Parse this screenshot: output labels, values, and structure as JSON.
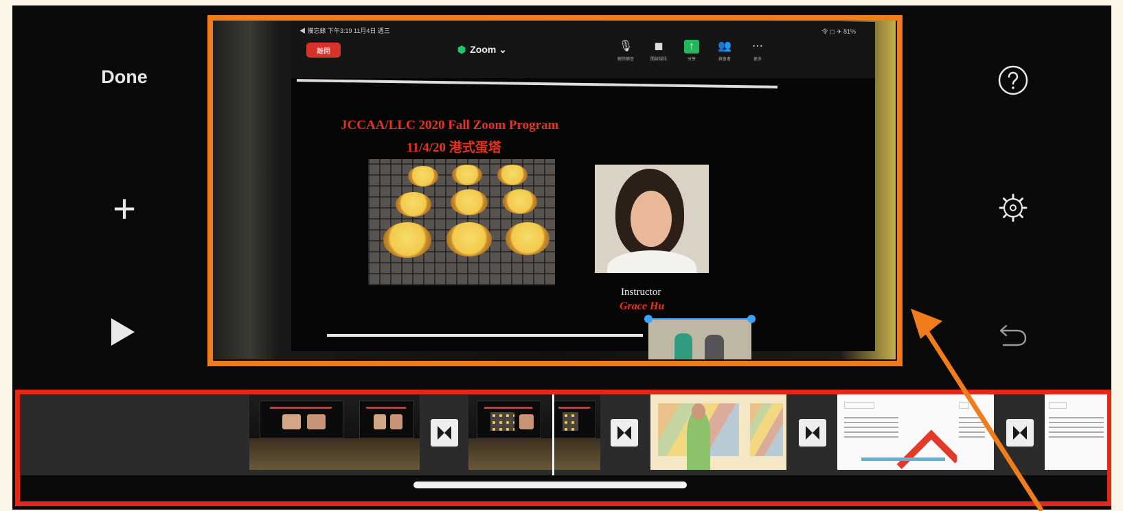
{
  "app": {
    "done_label": "Done",
    "plus_glyph": "+",
    "icons": {
      "play": "play-icon",
      "help": "question-icon",
      "settings": "gear-icon",
      "undo": "undo-icon",
      "transition": "transition-bowtie-icon"
    }
  },
  "viewer": {
    "zoom": {
      "status": "◀ 備忘錄  下午3:19  11月4日 週三",
      "battery": "令 ◻ ✈ 81%",
      "leave_label": "離開",
      "meeting_title": "Zoom ⌄",
      "toolbar": [
        "解除靜音",
        "開啟視訊",
        "分享",
        "與會者",
        "更多"
      ]
    },
    "slide": {
      "title": "JCCAA/LLC 2020 Fall Zoom Program",
      "subtitle": "11/4/20 港式蛋塔",
      "instructor_label": "Instructor",
      "instructor_name": "Grace Hu"
    }
  },
  "colors": {
    "viewer_frame": "#f07c1c",
    "timeline_frame": "#e02a17",
    "background": "#fbf6e7",
    "zoom_leave": "#d8322a",
    "zoom_share": "#20b85a",
    "slide_red": "#e8321c",
    "pip_selection": "#3ba2ff"
  }
}
